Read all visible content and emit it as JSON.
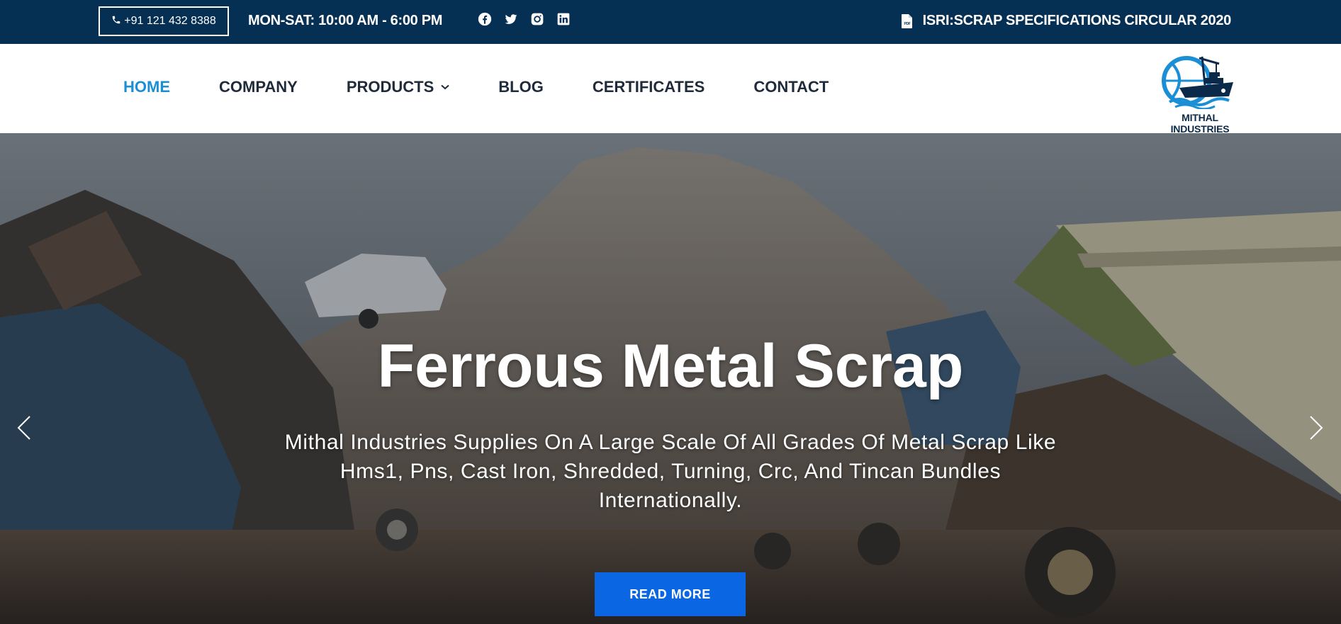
{
  "topbar": {
    "phone": "+91 121 432 8388",
    "hours": "MON-SAT: 10:00 AM - 6:00 PM",
    "socials": [
      "facebook-icon",
      "twitter-icon",
      "instagram-icon",
      "linkedin-icon"
    ],
    "circular_label": "ISRI:SCRAP SPECIFICATIONS CIRCULAR 2020",
    "background": "#053054"
  },
  "nav": {
    "items": [
      {
        "label": "HOME",
        "active": true
      },
      {
        "label": "COMPANY"
      },
      {
        "label": "PRODUCTS",
        "has_dropdown": true
      },
      {
        "label": "BLOG"
      },
      {
        "label": "CERTIFICATES"
      },
      {
        "label": "CONTACT"
      }
    ],
    "active_color": "#1b8fd6",
    "text_color": "#1f2b3a"
  },
  "logo": {
    "text": "MITHAL INDUSTRIES"
  },
  "hero": {
    "title": "Ferrous Metal Scrap",
    "subtitle": "Mithal Industries Supplies On A Large Scale Of All Grades Of Metal Scrap Like Hms1, Pns, Cast Iron, Shredded, Turning, Crc, And Tincan Bundles Internationally.",
    "button_label": "READ MORE",
    "button_color": "#0b66e4"
  }
}
